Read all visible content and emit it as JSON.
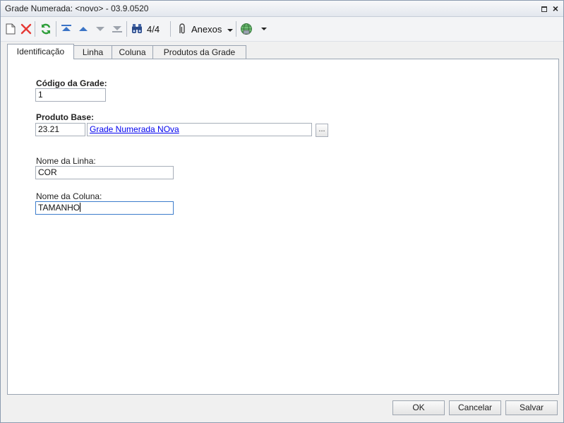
{
  "window": {
    "title": "Grade Numerada: <novo> - 03.9.0520"
  },
  "toolbar": {
    "record_count": "4/4",
    "anexos_label": "Anexos",
    "icons": [
      "new-document-icon",
      "delete-icon",
      "refresh-icon",
      "first-record-icon",
      "previous-record-icon",
      "next-record-icon",
      "last-record-icon",
      "binoculars-icon",
      "paperclip-icon",
      "globe-icon"
    ]
  },
  "tabs": [
    {
      "label": "Identificação",
      "active": true
    },
    {
      "label": "Linha",
      "active": false
    },
    {
      "label": "Coluna",
      "active": false
    },
    {
      "label": "Produtos da Grade",
      "active": false
    }
  ],
  "form": {
    "codigo_label": "Código da Grade:",
    "codigo_value": "1",
    "produto_label": "Produto Base:",
    "produto_code": "23.21",
    "produto_name": "Grade Numerada NOva",
    "lookup_label": "...",
    "linha_label": "Nome da Linha:",
    "linha_value": "COR",
    "coluna_label": "Nome da Coluna:",
    "coluna_value": "TAMANHO"
  },
  "buttons": {
    "ok": "OK",
    "cancel": "Cancelar",
    "save": "Salvar"
  },
  "colors": {
    "link": "#0000ee",
    "focus_border": "#3d7dcc",
    "delete_red": "#e53935",
    "refresh_green": "#2e9e3a",
    "nav_blue": "#3b74c6"
  }
}
